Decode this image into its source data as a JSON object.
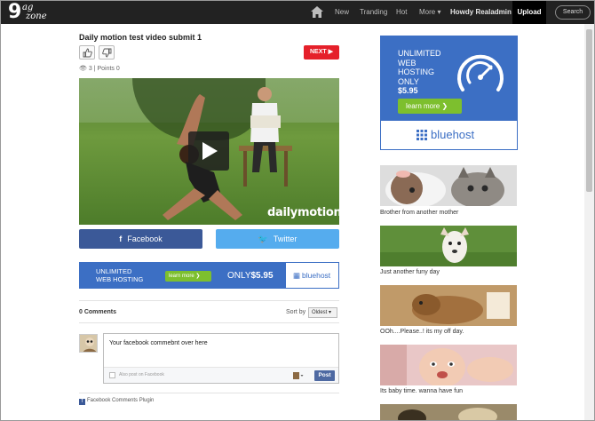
{
  "nav": {
    "logo_mark": "9",
    "logo_line1": "ag",
    "logo_line2": "zone",
    "items": [
      "New",
      "Tranding",
      "Hot",
      "More ▾"
    ],
    "user": "Howdy Realadmin ▾",
    "upload": "Upload",
    "search": "Search"
  },
  "post": {
    "title": "Daily motion test video submit 1",
    "next_label": "NEXT ▶",
    "views": "3",
    "points_label": "Points",
    "points": "0",
    "video_watermark": "dailymotion"
  },
  "share": {
    "facebook_icon": "f",
    "facebook": "Facebook",
    "twitter_icon": "🐦",
    "twitter": "Twitter"
  },
  "banner_ad": {
    "line1": "UNLIMITED",
    "line2": "WEB HOSTING",
    "cta": "learn more ❯",
    "price_prefix": "ONLY",
    "price": "$5.95",
    "brand": "bluehost"
  },
  "comments": {
    "count_label": "0 Comments",
    "sort_label": "Sort by",
    "sort_value": "Oldest ▾",
    "input_value": "Your facebook commebnt over here",
    "also_post": "Also post on Facebook",
    "post_button": "Post",
    "plugin": "Facebook Comments Plugin"
  },
  "side_ad": {
    "line1": "UNLIMITED",
    "line2": "WEB",
    "line3": "HOSTING",
    "line4": "ONLY",
    "price": "$5.95",
    "cta": "learn more ❯",
    "brand": "bluehost"
  },
  "side_list": [
    {
      "caption": "Brother from another mother"
    },
    {
      "caption": "Just another funy day"
    },
    {
      "caption": "OOh....Please..! its my off day."
    },
    {
      "caption": "Its baby time. wanna have fun"
    }
  ],
  "colors": {
    "nav_bg": "#222222",
    "next_red": "#e5202a",
    "facebook_blue": "#3b5998",
    "twitter_blue": "#55acee",
    "bluehost_blue": "#3c6fc4",
    "bluehost_green": "#7dbf2e"
  }
}
